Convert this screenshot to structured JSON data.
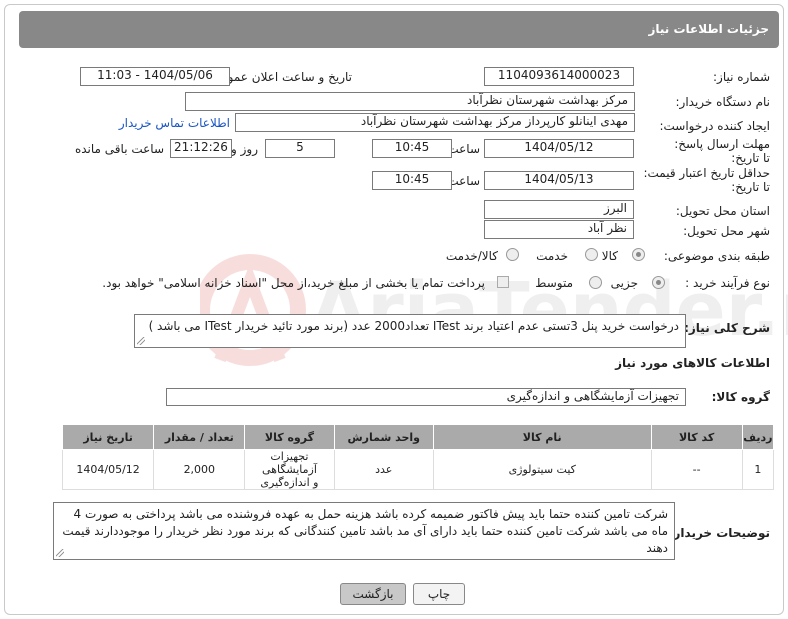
{
  "header": {
    "title": "جزئیات اطلاعات نیاز"
  },
  "form": {
    "need_number_label": "شماره نیاز:",
    "need_number": "1104093614000023",
    "announce_label": "تاریخ و ساعت اعلان عمومی:",
    "announce_value": "1404/05/06 - 11:03",
    "buyer_org_label": "نام دستگاه خریدار:",
    "buyer_org": "مرکز بهداشت شهرستان نظرآباد",
    "requester_label": "ایجاد کننده درخواست:",
    "requester": "مهدی اینانلو کارپرداز مرکز بهداشت شهرستان نظرآباد",
    "buyer_contact_link": "اطلاعات تماس خریدار",
    "reply_deadline_label": "مهلت ارسال پاسخ: تا تاریخ:",
    "reply_date": "1404/05/12",
    "time_label": "ساعت",
    "reply_time": "10:45",
    "days_value": "5",
    "days_label": "روز و",
    "remaining_time": "21:12:26",
    "remaining_label": "ساعت باقی مانده",
    "price_validity_label": "حداقل تاریخ اعتبار قیمت: تا تاریخ:",
    "price_date": "1404/05/13",
    "price_time": "10:45",
    "province_label": "استان محل تحویل:",
    "province": "البرز",
    "city_label": "شهر محل تحویل:",
    "city": "نظر آباد",
    "category_label": "طبقه بندی موضوعی:",
    "category_options": [
      "کالا",
      "خدمت",
      "کالا/خدمت"
    ],
    "process_label": "نوع فرآیند خرید :",
    "process_options": [
      "جزیی",
      "متوسط"
    ],
    "treasury_note": "پرداخت تمام یا بخشی از مبلغ خرید،از محل \"اسناد خزانه اسلامی\" خواهد بود.",
    "summary_label": "شرح کلی نیاز:",
    "summary": "درخواست خرید پنل 3تستی عدم اعتیاد برند ITest تعداد2000 عدد (برند مورد تائید خریدار ITest  می باشد )"
  },
  "goods": {
    "section_title": "اطلاعات کالاهای مورد نیاز",
    "group_label": "گروه کالا:",
    "group_value": "تجهیزات آزمایشگاهی و اندازه‌گیری",
    "columns": [
      "ردیف",
      "کد کالا",
      "نام کالا",
      "واحد شمارش",
      "گروه کالا",
      "تعداد / مقدار",
      "تاریخ نیاز"
    ],
    "rows": [
      {
        "index": "1",
        "code": "--",
        "name": "کیت سیتولوژی",
        "unit": "عدد",
        "group": "تجهیزات آزمایشگاهی و اندازه‌گیری",
        "qty": "2,000",
        "date": "1404/05/12"
      }
    ]
  },
  "buyer_notes": {
    "label": "توضیحات خریدار:",
    "text": "شرکت تامین کننده حتما باید پیش فاکتور ضمیمه کرده باشد هزینه حمل به عهده فروشنده می باشد پرداختی به صورت 4 ماه می باشد شرکت تامین کننده حتما باید دارای آی مد باشد تامین کنندگانی که برند مورد نظر خریدار را موجوددارند قیمت دهند"
  },
  "actions": {
    "print_label": "چاپ",
    "back_label": "بازگشت"
  },
  "watermark": {
    "text": "AriaTender.net"
  }
}
